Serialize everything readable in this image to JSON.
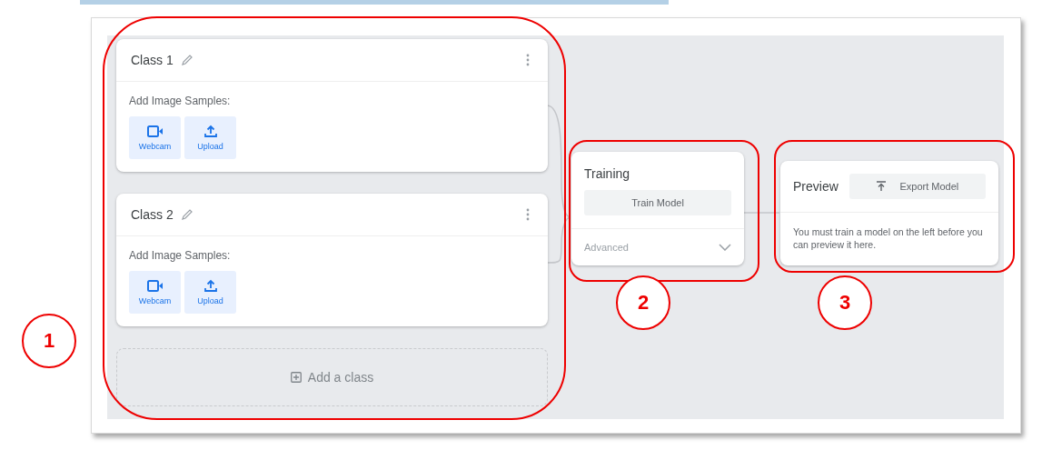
{
  "classes": [
    {
      "name": "Class 1",
      "samples_label": "Add Image Samples:",
      "sources": [
        {
          "kind": "webcam",
          "label": "Webcam"
        },
        {
          "kind": "upload",
          "label": "Upload"
        }
      ]
    },
    {
      "name": "Class 2",
      "samples_label": "Add Image Samples:",
      "sources": [
        {
          "kind": "webcam",
          "label": "Webcam"
        },
        {
          "kind": "upload",
          "label": "Upload"
        }
      ]
    }
  ],
  "add_class": "Add a class",
  "training": {
    "title": "Training",
    "button": "Train Model",
    "advanced": "Advanced",
    "expanded": false
  },
  "preview": {
    "title": "Preview",
    "export_button": "Export Model",
    "message": "You must train a model on the left before you can preview it here."
  },
  "callouts": [
    "1",
    "2",
    "3"
  ]
}
